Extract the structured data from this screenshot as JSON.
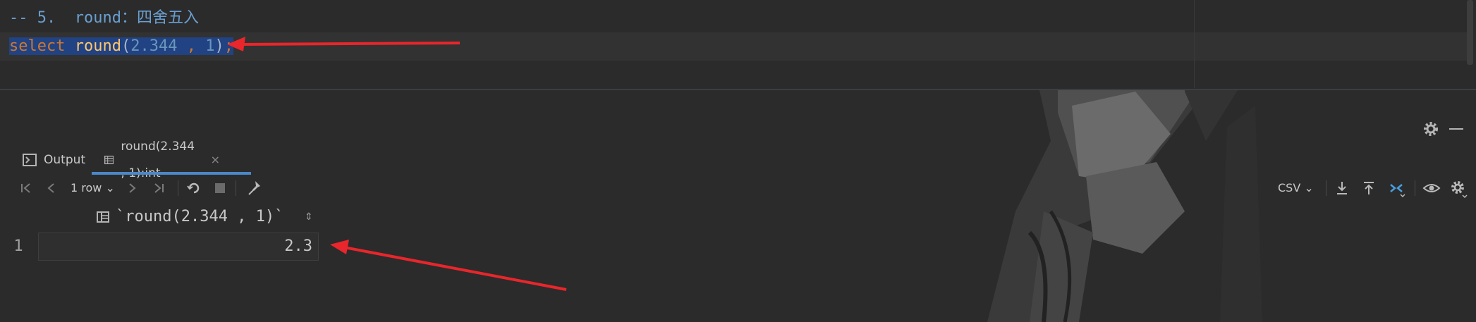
{
  "editor": {
    "line1": {
      "prefix": "-- 5.  ",
      "keyword": "round",
      "rest": "：四舍五入"
    },
    "line2": {
      "select": "select",
      "space": " ",
      "fn": "round",
      "open": "(",
      "arg1": "2.344",
      "comma": " , ",
      "arg2": "1",
      "close": ")",
      "semi": ";"
    }
  },
  "panel": {
    "settings_icon": "gear-icon",
    "minimize_icon": "minus-icon"
  },
  "tabs": [
    {
      "label": "Output",
      "icon": "console-icon",
      "active": false
    },
    {
      "label": "round(2.344 , 1):int",
      "icon": "table-icon",
      "active": true,
      "close": "×"
    }
  ],
  "toolbar": {
    "first_page": "first-page-icon",
    "prev_page": "prev-page-icon",
    "rows": "1 row",
    "rows_chevron": "⌄",
    "next_page": "next-page-icon",
    "last_page": "last-page-icon",
    "refresh": "refresh-icon",
    "stop": "stop-icon",
    "pin": "pin-icon",
    "export_format": "CSV",
    "export_chevron": "⌄",
    "download": "download-icon",
    "upload": "upload-icon",
    "compare": "compare-icon",
    "view": "eye-icon",
    "settings": "gear-icon"
  },
  "grid": {
    "column_header": "`round(2.344 , 1)`",
    "sort_glyph": "⇕",
    "rows": [
      {
        "num": "1",
        "value": "2.3"
      }
    ]
  },
  "colors": {
    "accent": "#4a88c7",
    "selection": "#214283",
    "arrow": "#e8262b"
  }
}
